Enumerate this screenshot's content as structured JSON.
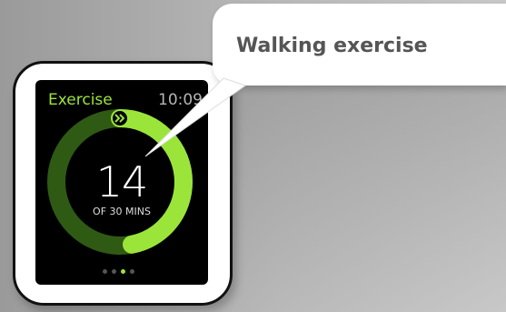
{
  "callout": {
    "label": "Walking exercise"
  },
  "watch": {
    "app_title": "Exercise",
    "time": "10:09",
    "value": "14",
    "goal_text": "OF 30 MINS",
    "progress_fraction": 0.47,
    "page_dots": {
      "count": 4,
      "active_index": 2
    },
    "colors": {
      "accent": "#9be53b",
      "ring_track": "#2f5a14",
      "ring_fill": "#9be53b"
    }
  }
}
